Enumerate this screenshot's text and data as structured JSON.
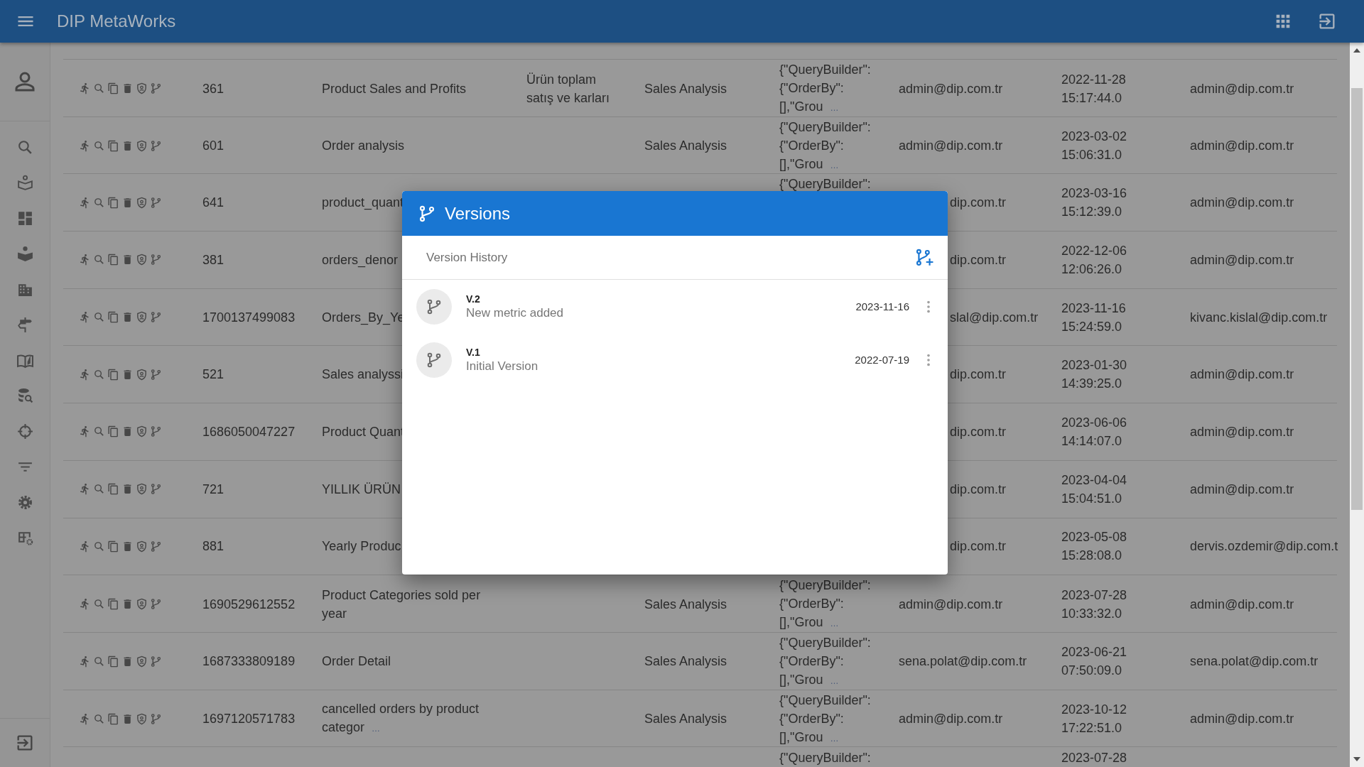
{
  "app_bar": {
    "title": "DIP MetaWorks"
  },
  "table": {
    "rows": [
      {
        "id": "361",
        "name": "Product Sales and Profits",
        "description": "Ürün toplam satış ve karları",
        "category": "Sales Analysis",
        "query": "{\"QueryBuilder\": {\"OrderBy\": [],\"Grou",
        "query_more": "…",
        "created_by": "admin@dip.com.tr",
        "created": "2022-11-28 15:17:44.0",
        "updated_by": "admin@dip.com.tr"
      },
      {
        "id": "601",
        "name": "Order analysis",
        "category": "Sales Analysis",
        "query": "{\"QueryBuilder\": {\"OrderBy\": [],\"Grou",
        "query_more": "…",
        "created_by": "admin@dip.com.tr",
        "created": "2023-03-02 15:06:31.0",
        "updated_by": "admin@dip.com.tr"
      },
      {
        "id": "641",
        "name": "product_quant",
        "query": "{\"QueryBuilder\":",
        "created_by_tail": "dip.com.tr",
        "created": "2023-03-16 15:12:39.0",
        "updated_by": "admin@dip.com.tr"
      },
      {
        "id": "381",
        "name": "orders_denor",
        "created_by_tail": "dip.com.tr",
        "created": "2022-12-06 12:06:26.0",
        "updated_by": "admin@dip.com.tr"
      },
      {
        "id": "1700137499083",
        "name": "Orders_By_Ye",
        "created_by_tail": "slal@dip.com.tr",
        "created": "2023-11-16 15:24:59.0",
        "updated_by": "kivanc.kislal@dip.com.tr"
      },
      {
        "id": "521",
        "name": "Sales analyssi",
        "created_by_tail": "dip.com.tr",
        "created": "2023-01-30 14:39:25.0",
        "updated_by": "admin@dip.com.tr"
      },
      {
        "id": "1686050047227",
        "name": "Product Quant",
        "created_by_tail": "dip.com.tr",
        "created": "2023-06-06 14:14:07.0",
        "updated_by": "admin@dip.com.tr"
      },
      {
        "id": "721",
        "name": "YILLIK ÜRÜN",
        "created_by_tail": "dip.com.tr",
        "created": "2023-04-04 15:04:51.0",
        "updated_by": "admin@dip.com.tr"
      },
      {
        "id": "881",
        "name": "Yearly Produc",
        "created_by_tail": "dip.com.tr",
        "created": "2023-05-08 15:28:08.0",
        "updated_by": "dervis.ozdemir@dip.com.t"
      },
      {
        "id": "1690529612552",
        "name": "Product Categories sold per year",
        "category": "Sales Analysis",
        "query": "{\"QueryBuilder\": {\"OrderBy\": [],\"Grou",
        "query_more": "…",
        "created_by": "admin@dip.com.tr",
        "created": "2023-07-28 10:33:32.0",
        "updated_by": "admin@dip.com.tr"
      },
      {
        "id": "1687333809189",
        "name": "Order Detail",
        "category": "Sales Analysis",
        "query": "{\"QueryBuilder\": {\"OrderBy\": [],\"Grou",
        "query_more": "…",
        "created_by": "sena.polat@dip.com.tr",
        "created": "2023-06-21 07:50:09.0",
        "updated_by": "sena.polat@dip.com.tr"
      },
      {
        "id": "1697120571783",
        "name": "cancelled orders by product categor",
        "name_more": "…",
        "category": "Sales Analysis",
        "query": "{\"QueryBuilder\": {\"OrderBy\": [],\"Grou",
        "query_more": "…",
        "created_by": "admin@dip.com.tr",
        "created": "2023-10-12 17:22:51.0",
        "updated_by": "admin@dip.com.tr"
      }
    ],
    "partial_row": {
      "query": "{\"QueryBuilder\":",
      "created": "2023-07-28"
    }
  },
  "dialog": {
    "title": "Versions",
    "subheader": "Version History",
    "versions": [
      {
        "label": "V.2",
        "description": "New metric added",
        "date": "2023-11-16"
      },
      {
        "label": "V.1",
        "description": "Initial Version",
        "date": "2022-07-19"
      }
    ]
  }
}
